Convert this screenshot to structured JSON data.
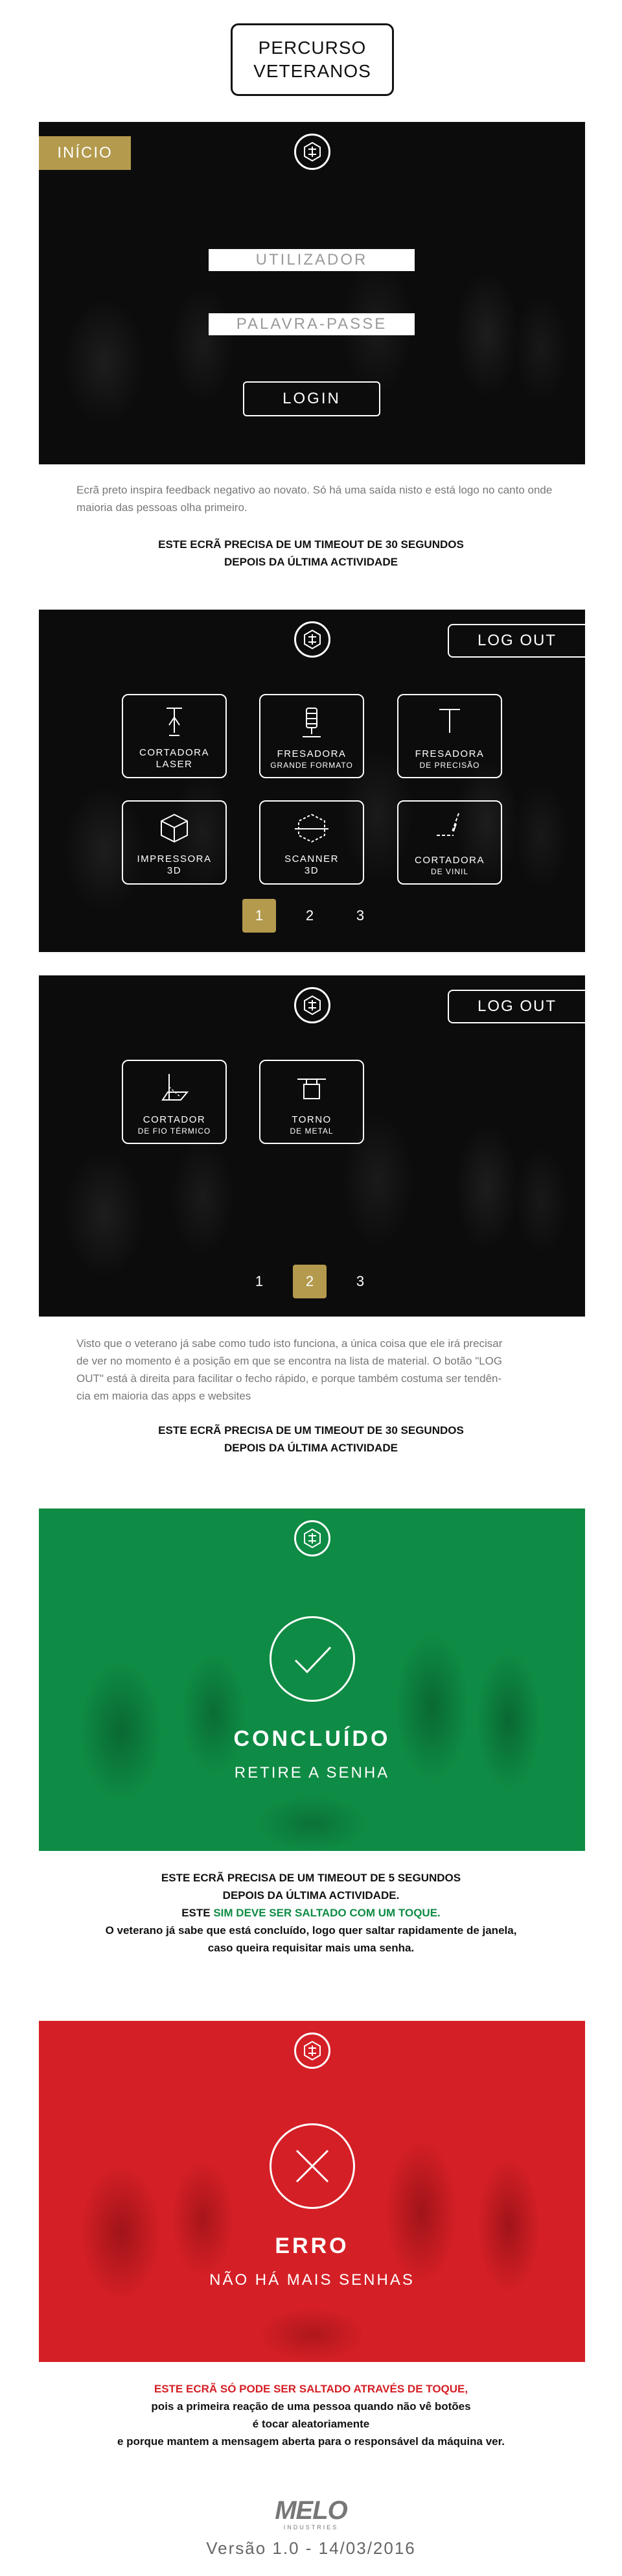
{
  "header": {
    "title_line1": "PERCURSO",
    "title_line2": "VETERANOS"
  },
  "login_screen": {
    "start_tag": "INÍCIO",
    "username_placeholder": "UTILIZADOR",
    "password_placeholder": "PALAVRA-PASSE",
    "login_button": "LOGIN"
  },
  "note1": {
    "text": "Ecrã preto inspira feedback negativo ao novato. Só há uma saída nisto e está logo no canto onde maioria das pessoas olha primeiro.",
    "emphasis_line1": "ESTE ECRÃ PRECISA DE UM TIMEOUT DE 30 SEGUNDOS",
    "emphasis_line2": "DEPOIS DA ÚLTIMA ACTIVIDADE"
  },
  "menu_page1": {
    "logout": "LOG OUT",
    "tiles": [
      {
        "line1": "CORTADORA",
        "line2": "LASER",
        "icon": "laser-cutter-icon"
      },
      {
        "line1": "FRESADORA",
        "line2": "GRANDE FORMATO",
        "icon": "large-mill-icon"
      },
      {
        "line1": "FRESADORA",
        "line2": "DE PRECISÃO",
        "icon": "precision-mill-icon"
      },
      {
        "line1": "IMPRESSORA",
        "line2": "3D",
        "icon": "3d-printer-icon"
      },
      {
        "line1": "SCANNER",
        "line2": "3D",
        "icon": "3d-scanner-icon"
      },
      {
        "line1": "CORTADORA",
        "line2": "DE VINIL",
        "icon": "vinyl-cutter-icon"
      }
    ],
    "pages": [
      "1",
      "2",
      "3"
    ],
    "active_page": "1"
  },
  "menu_page2": {
    "logout": "LOG OUT",
    "tiles": [
      {
        "line1": "CORTADOR",
        "line2": "DE FIO TÉRMICO",
        "icon": "hot-wire-cutter-icon"
      },
      {
        "line1": "TORNO",
        "line2": "DE METAL",
        "icon": "metal-lathe-icon"
      }
    ],
    "pages": [
      "1",
      "2",
      "3"
    ],
    "active_page": "2"
  },
  "note2": {
    "line1": "Visto que o veterano já sabe como tudo isto funciona, a única coisa que ele irá precisar",
    "line2": "de ver no momento é a posição em que se encontra na lista de material. O botão \"LOG",
    "line3": "OUT\" está à direita para facilitar o fecho rápido, e porque também costuma ser tendên-",
    "line4": "cia em maioria das apps e websites",
    "emphasis_line1": "ESTE ECRÃ PRECISA DE UM TIMEOUT DE 30 SEGUNDOS",
    "emphasis_line2": "DEPOIS DA ÚLTIMA ACTIVIDADE"
  },
  "success_screen": {
    "title": "CONCLUÍDO",
    "subtitle": "RETIRE A SENHA"
  },
  "note3": {
    "line1": "ESTE ECRÃ PRECISA DE UM TIMEOUT DE 5 SEGUNDOS",
    "line2": "DEPOIS DA ÚLTIMA ACTIVIDADE.",
    "line3_pre": "ESTE ",
    "line3_highlight": "SIM DEVE SER SALTADO COM UM TOQUE.",
    "line4": "O veterano já sabe que está concluído, logo quer saltar rapidamente de janela,",
    "line5": "caso queira requisitar mais uma senha."
  },
  "error_screen": {
    "title": "ERRO",
    "subtitle": "NÃO HÁ MAIS SENHAS"
  },
  "note4": {
    "line1": "ESTE ECRÃ SÓ PODE SER SALTADO ATRAVÉS DE TOQUE,",
    "line2": "pois a primeira reação de uma pessoa quando não vê botões",
    "line3": "é tocar aleatoriamente",
    "line4": "e porque mantem a mensagem aberta para o responsável da máquina ver."
  },
  "footer": {
    "brand": "MELO",
    "brand_sub": "INDUSTRIES",
    "version": "Versão 1.0 - 14/03/2016"
  },
  "colors": {
    "gold": "#b49a4d",
    "success_green": "#0e8b44",
    "error_red": "#d51f26",
    "dark_screen": "#0c0c0c"
  }
}
